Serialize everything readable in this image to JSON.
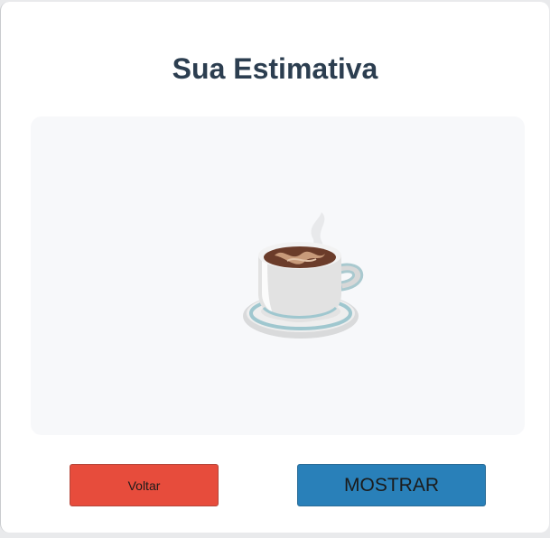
{
  "page": {
    "title": "Sua Estimativa"
  },
  "display": {
    "icon": "coffee-cup-icon"
  },
  "buttons": {
    "back_label": "Voltar",
    "show_label": "MOSTRAR"
  },
  "colors": {
    "title": "#2c3e50",
    "back_button": "#e74c3c",
    "show_button": "#2980b9",
    "display_background": "#f7f8fa"
  }
}
